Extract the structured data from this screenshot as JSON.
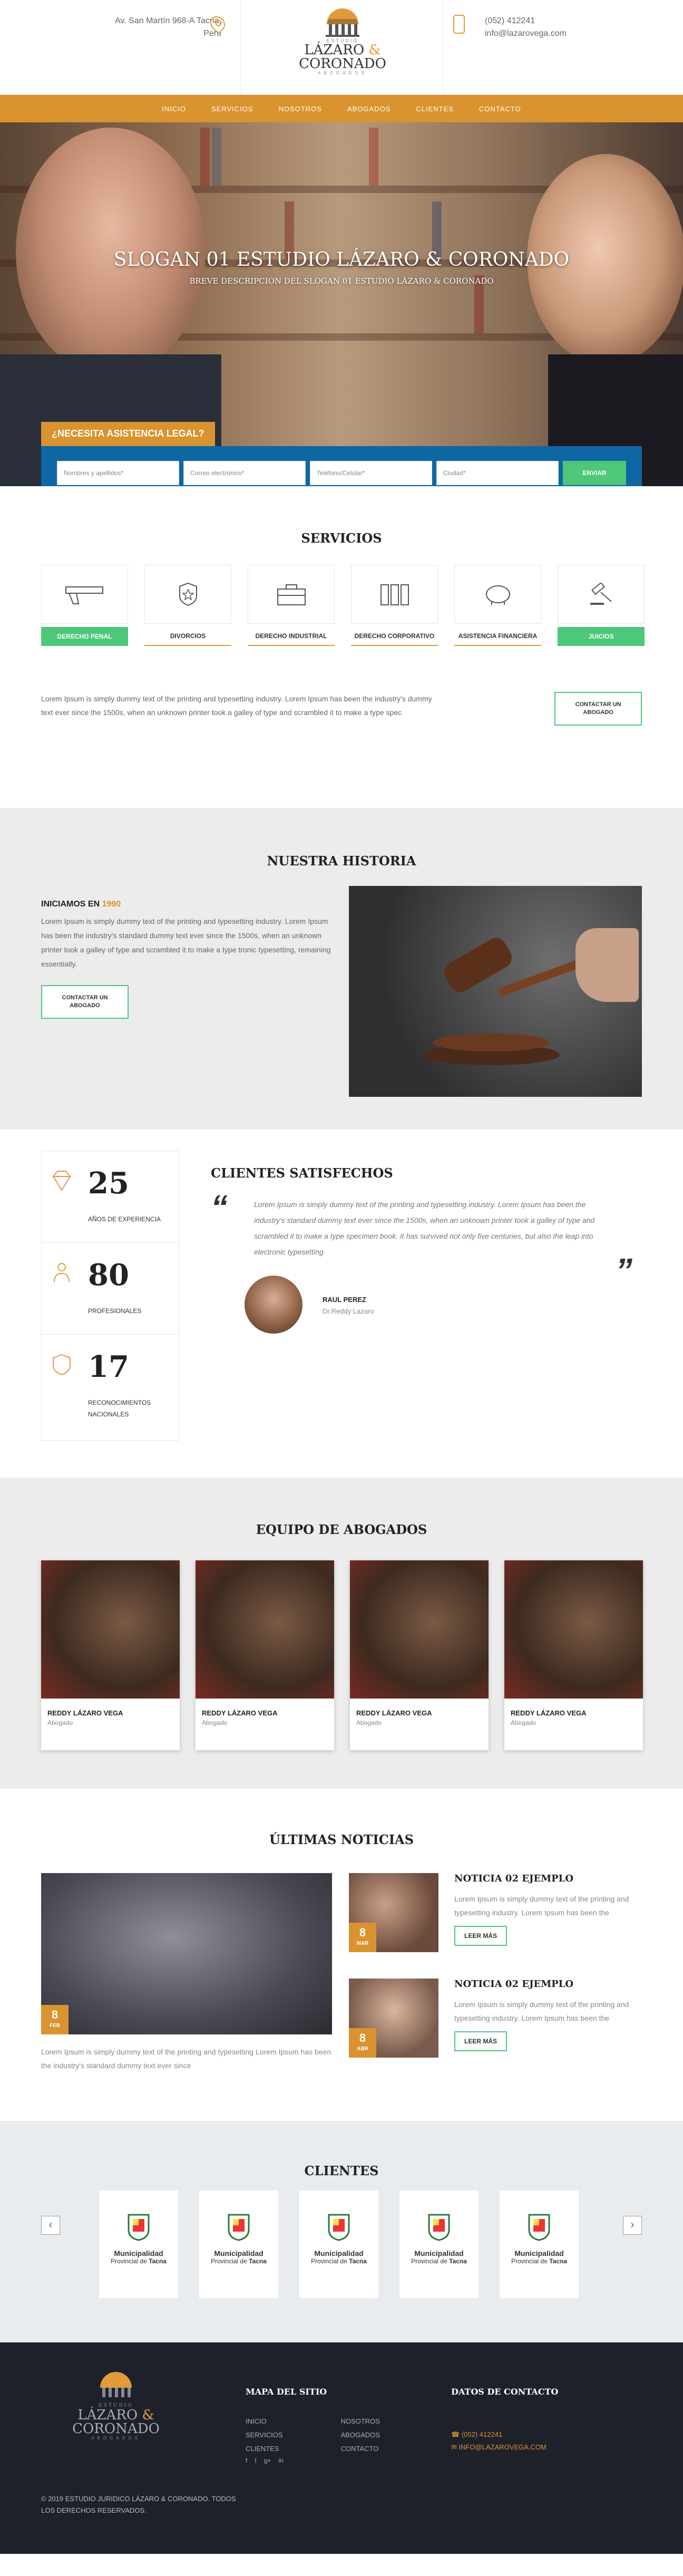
{
  "header": {
    "address_line1": "Av. San Martín 968-A Tacna,",
    "address_line2": "Peru",
    "logo_top": "ESTUDIO",
    "logo_name1": "LÁZARO",
    "logo_amp": "&",
    "logo_name2": "CORONADO",
    "logo_bottom": "ABOGADOS",
    "phone": "(052) 412241",
    "email": "info@lazarovega.com"
  },
  "nav": {
    "items": [
      "INICIO",
      "SERVICIOS",
      "NOSOTROS",
      "ABOGADOS",
      "CLIENTES",
      "CONTACTO"
    ]
  },
  "hero": {
    "title": "SLOGAN 01 ESTUDIO LÁZARO & CORONADO",
    "subtitle": "BREVE DESCRIPCION DEL SLOGAN 01 ESTUDIO LÁZARO & CORONADO",
    "legal_tab": "¿NECESITA ASISTENCIA LEGAL?",
    "form": {
      "name_placeholder": "Nombres y apellidos*",
      "email_placeholder": "Correo electrónico*",
      "phone_placeholder": "Teléfono/Celular*",
      "city_placeholder": "Ciudad*",
      "send_label": "ENVIAR"
    }
  },
  "services": {
    "title": "SERVICIOS",
    "items": [
      {
        "label": "DERECHO PENAL",
        "icon": "gun-icon"
      },
      {
        "label": "DIVORCIOS",
        "icon": "badge-icon"
      },
      {
        "label": "DERECHO INDUSTRIAL",
        "icon": "briefcase-icon"
      },
      {
        "label": "DERECHO CORPORATIVO",
        "icon": "folders-icon"
      },
      {
        "label": "ASISTENCIA FINANCIERA",
        "icon": "piggy-bank-icon"
      },
      {
        "label": "JUICIOS",
        "icon": "gavel-icon"
      }
    ],
    "text": "Lorem Ipsum is simply dummy text of the printing and typesetting industry. Lorem Ipsum has been the industry's dummy text ever since the 1500s, when an unknown printer took a galley of type and scrambled it to make a type spec",
    "contact_button": "CONTACTAR UN ABOGADO"
  },
  "historia": {
    "title": "NUESTRA HISTORIA",
    "subheading": "INICIAMOS EN",
    "year": "1990",
    "text": "Lorem Ipsum is simply dummy text of the printing and typesetting industry. Lorem Ipsum has been the industry's standard dummy text ever since the 1500s, when an unknown printer took a galley of type and scrambled it to make a type tronic typesetting, remaining essentially.",
    "contact_button": "CONTACTAR UN ABOGADO"
  },
  "stats": [
    {
      "number": "25",
      "caption": "AÑOS DE EXPERIENCIA",
      "icon": "diamond-icon"
    },
    {
      "number": "80",
      "caption": "PROFESIONALES",
      "icon": "people-icon"
    },
    {
      "number": "17",
      "caption": "RECONOCIMIENTOS NACIONALES",
      "icon": "shield-icon"
    }
  ],
  "testimonial": {
    "title": "CLIENTES SATISFECHOS",
    "quote": "Lorem Ipsum is simply dummy text of the printing and typesetting industry. Lorem Ipsum has been the industry's standard dummy text ever since the 1500s, when an unknown printer took a galley of type and scrambled it to make a type specimen book. It has survived not only five centuries, but also the leap into electronic typesetting.",
    "name": "RAUL PEREZ",
    "role": "Dr.Reddy Lazaro"
  },
  "team": {
    "title": "EQUIPO DE ABOGADOS",
    "members": [
      {
        "name": "REDDY LÁZARO VEGA",
        "role": "Abogado"
      },
      {
        "name": "REDDY LÁZARO VEGA",
        "role": "Abogado"
      },
      {
        "name": "REDDY LÁZARO VEGA",
        "role": "Abogado"
      },
      {
        "name": "REDDY LÁZARO VEGA",
        "role": "Abogado"
      }
    ]
  },
  "news": {
    "title": "ÚLTIMAS NOTICIAS",
    "main": {
      "day": "8",
      "month": "FEB",
      "text": "Lorem Ipsum is simply dummy text of the printing and typesetting Lorem Ipsum has been the industry's standard dummy text ever since"
    },
    "items": [
      {
        "day": "8",
        "month": "MAR",
        "title": "NOTICIA 02 EJEMPLO",
        "text": "Lorem Ipsum is simply dummy text of the printing and typesetting industry. Lorem Ipsum has been the",
        "button": "LEER MÁS"
      },
      {
        "day": "8",
        "month": "ABR",
        "title": "NOTICIA 02 EJEMPLO",
        "text": "Lorem Ipsum is simply dummy text of the printing and typesetting industry. Lorem Ipsum has been the",
        "button": "LEER MÁS"
      }
    ]
  },
  "clients": {
    "title": "CLIENTES",
    "prev": "‹",
    "next": "›",
    "items": [
      {
        "line1": "Municipalidad",
        "line2a": "Provincial de ",
        "line2b": "Tacna"
      },
      {
        "line1": "Municipalidad",
        "line2a": "Provincial de ",
        "line2b": "Tacna"
      },
      {
        "line1": "Municipalidad",
        "line2a": "Provincial de ",
        "line2b": "Tacna"
      },
      {
        "line1": "Municipalidad",
        "line2a": "Provincial de ",
        "line2b": "Tacna"
      },
      {
        "line1": "Municipalidad",
        "line2a": "Provincial de ",
        "line2b": "Tacna"
      }
    ]
  },
  "footer": {
    "copyright": "© 2019 ESTUDIO JURIDICO LÁZARO & CORONADO. TODOS LOS DERECHOS RESERVADOS.",
    "sitemap_title": "MAPA DEL SITIO",
    "sitemap_col1": [
      "INICIO",
      "SERVICIOS",
      "CLIENTES"
    ],
    "sitemap_col2": [
      "NOSOTROS",
      "ABOGADOS",
      "CONTACTO"
    ],
    "social": [
      "f",
      "t",
      "g+",
      "in"
    ],
    "contact_title": "DATOS DE CONTACTO",
    "contact_phone": "(052) 412241",
    "contact_email": "INFO@LAZAROVEGA.COM"
  },
  "colors": {
    "accent": "#d9932f",
    "green": "#4ec77a",
    "blue": "#0e67a2",
    "footer": "#1e2129"
  }
}
